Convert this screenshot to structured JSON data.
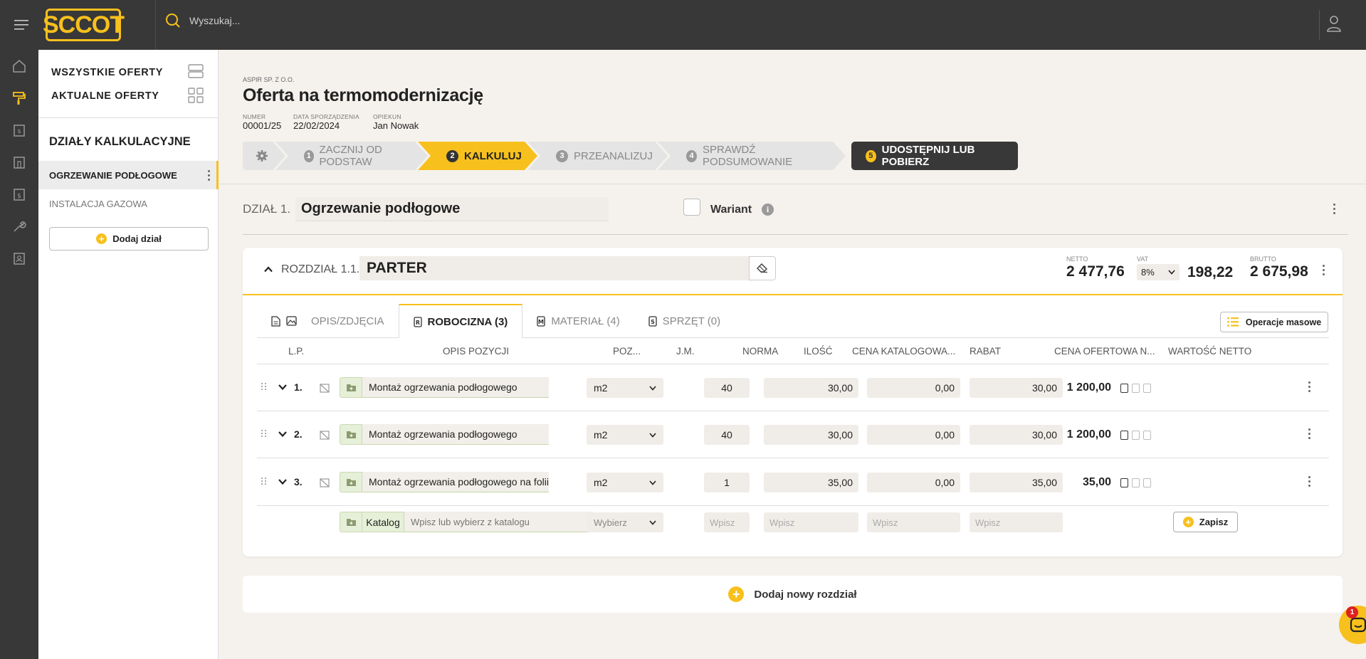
{
  "brand": {
    "logo_text": "SCCOT",
    "accent": "#f7c01d",
    "dark": "#383838"
  },
  "search": {
    "placeholder": "Wyszukaj..."
  },
  "sidebar": {
    "links": [
      "WSZYSTKIE OFERTY",
      "AKTUALNE OFERTY"
    ],
    "section_title": "DZIAŁY KALKULACYJNE",
    "items": [
      {
        "label": "OGRZEWANIE PODŁOGOWE",
        "active": true
      },
      {
        "label": "INSTALACJA GAZOWA",
        "active": false
      }
    ],
    "add_label": "Dodaj dział"
  },
  "header": {
    "company": "ASPIR SP. Z O.O.",
    "title": "Oferta na termomodernizację",
    "meta": [
      {
        "label": "NUMER",
        "value": "00001/25"
      },
      {
        "label": "DATA SPORZĄDZENIA",
        "value": "22/02/2024"
      },
      {
        "label": "OPIEKUN",
        "value": "Jan Nowak"
      }
    ]
  },
  "steps": [
    {
      "num": "1",
      "label": "ZACZNIJ OD PODSTAW"
    },
    {
      "num": "2",
      "label": "KALKULUJ"
    },
    {
      "num": "3",
      "label": "PRZEANALIZUJ"
    },
    {
      "num": "4",
      "label": "SPRAWDŹ PODSUMOWANIE"
    },
    {
      "num": "5",
      "label": "UDOSTĘPNIJ LUB POBIERZ"
    }
  ],
  "dzial": {
    "label": "DZIAŁ 1.",
    "name": "Ogrzewanie podłogowe",
    "wariant_label": "Wariant"
  },
  "rozdzial": {
    "label": "ROZDZIAŁ 1.1.",
    "name": "PARTER",
    "netto_label": "NETTO",
    "netto": "2 477,76",
    "vat_label": "VAT",
    "vat_rate": "8%",
    "vat_value": "198,22",
    "brutto_label": "BRUTTO",
    "brutto": "2 675,98"
  },
  "tabs": [
    {
      "label": "OPIS/ZDJĘCIA",
      "active": false
    },
    {
      "label": "ROBOCIZNA (3)",
      "active": true
    },
    {
      "label": "MATERIAŁ (4)",
      "active": false
    },
    {
      "label": "SPRZĘT (0)",
      "active": false
    }
  ],
  "mass_ops_label": "Operacje masowe",
  "columns": [
    "L.P.",
    "OPIS POZYCJI",
    "POZ...",
    "J.M.",
    "NORMA",
    "ILOŚĆ",
    "CENA KATALOGOWA...",
    "RABAT",
    "CENA OFERTOWA N...",
    "WARTOŚĆ NETTO"
  ],
  "rows": [
    {
      "lp": "1.",
      "opis": "Montaż ogrzewania podłogowego",
      "jm": "m2",
      "ilosc": "40",
      "cena_kat": "30,00",
      "rabat": "0,00",
      "cena_of": "30,00",
      "wartosc": "1 200,00"
    },
    {
      "lp": "2.",
      "opis": "Montaż ogrzewania podłogowego",
      "jm": "m2",
      "ilosc": "40",
      "cena_kat": "30,00",
      "rabat": "0,00",
      "cena_of": "30,00",
      "wartosc": "1 200,00"
    },
    {
      "lp": "3.",
      "opis": "Montaż ogrzewania podłogowego na folii",
      "jm": "m2",
      "ilosc": "1",
      "cena_kat": "35,00",
      "rabat": "0,00",
      "cena_of": "35,00",
      "wartosc": "35,00"
    }
  ],
  "new_row": {
    "catalog_label": "Katalog",
    "opis_placeholder": "Wpisz lub wybierz z katalogu",
    "jm_placeholder": "Wybierz",
    "input_placeholder": "Wpisz",
    "save_label": "Zapisz"
  },
  "add_section_label": "Dodaj nowy rozdział",
  "chat": {
    "badge": "1"
  }
}
